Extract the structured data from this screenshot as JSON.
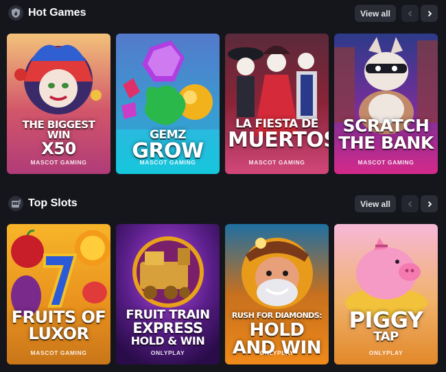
{
  "sections": [
    {
      "title": "Hot Games",
      "icon": "flame-shield-icon",
      "view_all": "View all",
      "games": [
        {
          "lines": [
            "The Biggest",
            "Win",
            "x50"
          ],
          "provider": "MASCOT GAMING",
          "colors": [
            "#e7a05b",
            "#c24a6e"
          ]
        },
        {
          "lines": [
            "Gemz",
            "Grow"
          ],
          "provider": "MASCOT GAMING",
          "colors": [
            "#3aa9e6",
            "#1ab8d8"
          ]
        },
        {
          "lines": [
            "La Fiesta de",
            "Muertos"
          ],
          "provider": "MASCOT GAMING",
          "colors": [
            "#4a1d2b",
            "#c43a6a"
          ]
        },
        {
          "lines": [
            "Scratch",
            "The Bank"
          ],
          "provider": "MASCOT GAMING",
          "colors": [
            "#2a3b7d",
            "#c02c8a"
          ]
        }
      ]
    },
    {
      "title": "Top Slots",
      "icon": "slot-machine-icon",
      "view_all": "View all",
      "games": [
        {
          "lines": [
            "Fruits of",
            "Luxor"
          ],
          "provider": "MASCOT GAMING",
          "colors": [
            "#f39a1d",
            "#c8731a"
          ]
        },
        {
          "lines": [
            "Fruit Train",
            "Express",
            "Hold & Win"
          ],
          "provider": "ONLYPLAY",
          "colors": [
            "#3d1566",
            "#8a2ac0"
          ]
        },
        {
          "lines": [
            "Rush for Diamonds:",
            "Hold and Win"
          ],
          "provider": "ONLYPLAY",
          "colors": [
            "#1c6e9b",
            "#e37b1e"
          ]
        },
        {
          "lines": [
            "Piggy",
            "Tap"
          ],
          "provider": "ONLYPLAY",
          "colors": [
            "#f2a7d0",
            "#e2882a"
          ]
        }
      ]
    }
  ]
}
